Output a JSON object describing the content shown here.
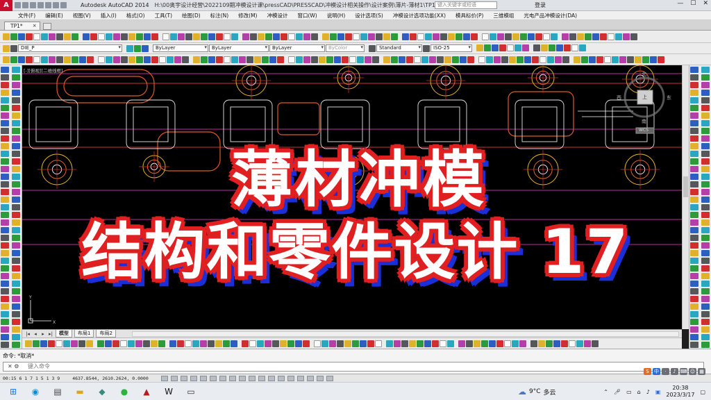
{
  "titlebar": {
    "app_title": "Autodesk AutoCAD 2014",
    "file_path": "H:\\00奥宇设计经营\\2022109期冲模设计课\\pressCAD\\PRESSCAD\\冲模设计相关操作\\设计案例\\薄片-薄材1\\TP1.dwg",
    "search_placeholder": "键入关键字或短语",
    "login": "登录",
    "minimize": "—",
    "maximize": "☐",
    "close": "✕"
  },
  "menu": [
    "文件(F)",
    "编辑(E)",
    "视图(V)",
    "插入(I)",
    "格式(O)",
    "工具(T)",
    "绘图(D)",
    "标注(N)",
    "修改(M)",
    "冲模设计",
    "窗口(W)",
    "说明(H)",
    "设计选项(S)",
    "冲模设计选项功能(XX)",
    "模具标价(P)",
    "三维模组",
    "光电产品冲模设计(DA)"
  ],
  "file_tab": {
    "label": "TP1*",
    "close": "×"
  },
  "toolbar": {
    "layer_value": "DIE_P",
    "color_value": "ByLayer",
    "linetype_value": "ByLayer",
    "lineweight_value": "ByLayer",
    "plotstyle_value": "ByColor",
    "textstyle_value": "Standard",
    "dimstyle_value": "ISO-25"
  },
  "viewport_label": "[-][俯视][二维线框]",
  "viewcube": {
    "north": "北",
    "south": "南",
    "east": "东",
    "west": "西",
    "top": "上",
    "wcs": "WCS"
  },
  "model_tabs": [
    "模型",
    "布局1",
    "布局2"
  ],
  "command": {
    "history": "命令: *取消*",
    "placeholder": "键入命令",
    "prefix": "✕  ⚙"
  },
  "status": {
    "coords": "4637.8544,  2610.2624,  0.0000",
    "left_text": "00:15 6 1 7 1 5 1 3 9"
  },
  "overlay": {
    "line1": "薄材冲模",
    "line2": "结构和零件设计 17"
  },
  "taskbar": {
    "weather_temp": "9°C",
    "weather_desc": "多云",
    "time": "20:38",
    "date": "2023/3/17",
    "ime_cn": "中"
  },
  "colors": {
    "overlay_fill": "#ffffff",
    "overlay_outline": "#e02020",
    "overlay_shadow": "#1b2fd6",
    "canvas": "#000000"
  }
}
